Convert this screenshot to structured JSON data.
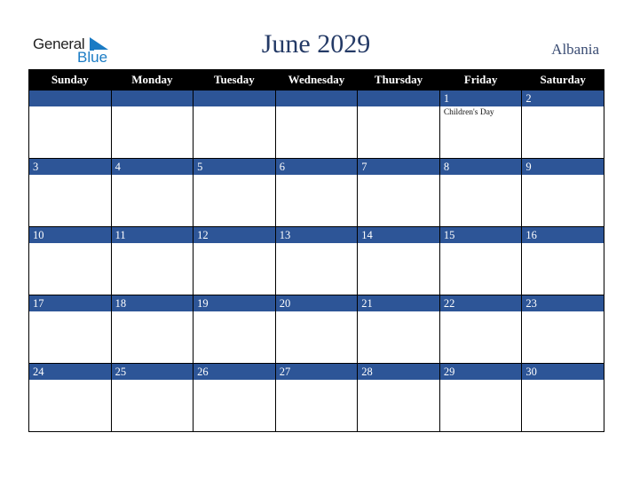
{
  "logo": {
    "line1": "General",
    "line2": "Blue"
  },
  "header": {
    "title": "June 2029",
    "country": "Albania"
  },
  "colors": {
    "accent": "#2d5597",
    "header_bg": "#000000",
    "title": "#243a66",
    "logo_blue": "#1a7bc4"
  },
  "weekdays": [
    "Sunday",
    "Monday",
    "Tuesday",
    "Wednesday",
    "Thursday",
    "Friday",
    "Saturday"
  ],
  "weeks": [
    [
      {
        "day": "",
        "event": ""
      },
      {
        "day": "",
        "event": ""
      },
      {
        "day": "",
        "event": ""
      },
      {
        "day": "",
        "event": ""
      },
      {
        "day": "",
        "event": ""
      },
      {
        "day": "1",
        "event": "Children's Day"
      },
      {
        "day": "2",
        "event": ""
      }
    ],
    [
      {
        "day": "3",
        "event": ""
      },
      {
        "day": "4",
        "event": ""
      },
      {
        "day": "5",
        "event": ""
      },
      {
        "day": "6",
        "event": ""
      },
      {
        "day": "7",
        "event": ""
      },
      {
        "day": "8",
        "event": ""
      },
      {
        "day": "9",
        "event": ""
      }
    ],
    [
      {
        "day": "10",
        "event": ""
      },
      {
        "day": "11",
        "event": ""
      },
      {
        "day": "12",
        "event": ""
      },
      {
        "day": "13",
        "event": ""
      },
      {
        "day": "14",
        "event": ""
      },
      {
        "day": "15",
        "event": ""
      },
      {
        "day": "16",
        "event": ""
      }
    ],
    [
      {
        "day": "17",
        "event": ""
      },
      {
        "day": "18",
        "event": ""
      },
      {
        "day": "19",
        "event": ""
      },
      {
        "day": "20",
        "event": ""
      },
      {
        "day": "21",
        "event": ""
      },
      {
        "day": "22",
        "event": ""
      },
      {
        "day": "23",
        "event": ""
      }
    ],
    [
      {
        "day": "24",
        "event": ""
      },
      {
        "day": "25",
        "event": ""
      },
      {
        "day": "26",
        "event": ""
      },
      {
        "day": "27",
        "event": ""
      },
      {
        "day": "28",
        "event": ""
      },
      {
        "day": "29",
        "event": ""
      },
      {
        "day": "30",
        "event": ""
      }
    ]
  ]
}
